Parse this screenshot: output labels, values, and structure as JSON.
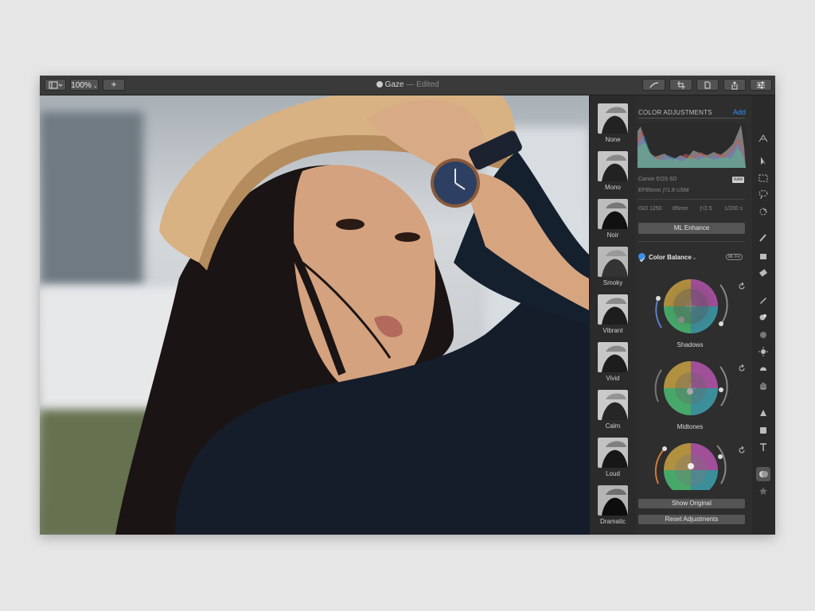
{
  "titlebar": {
    "zoom": "100%",
    "document_name": "Gaze",
    "status": "— Edited"
  },
  "presets": [
    {
      "label": "None"
    },
    {
      "label": "Mono"
    },
    {
      "label": "Noir"
    },
    {
      "label": "Smoky"
    },
    {
      "label": "Vibrant"
    },
    {
      "label": "Vivid"
    },
    {
      "label": "Calm"
    },
    {
      "label": "Loud"
    },
    {
      "label": "Dramatic"
    }
  ],
  "panel": {
    "title": "COLOR ADJUSTMENTS",
    "add_label": "Add",
    "camera": "Canon EOS 6D",
    "raw_badge": "RAW",
    "lens": "EF85mm ƒ/1.8 USM",
    "iso": "ISO 1250",
    "focal": "85mm",
    "aperture": "ƒ/2.5",
    "shutter": "1/200 s",
    "ml_enhance": "ML Enhance",
    "color_balance": "Color Balance",
    "ml_fix": "ML Fix",
    "wheels": [
      {
        "label": "Shadows"
      },
      {
        "label": "Midtones"
      },
      {
        "label": ""
      }
    ],
    "show_original": "Show Original",
    "reset": "Reset Adjustments"
  },
  "tools": [
    "repair-icon",
    "select-icon",
    "marquee-icon",
    "lasso-icon",
    "quick-select-icon",
    "brush-icon",
    "bucket-icon",
    "eraser-icon",
    "pencil-icon",
    "clone-icon",
    "blur-icon",
    "light-icon",
    "shape-icon",
    "hand-icon",
    "pen-icon",
    "rectangle-icon",
    "text-icon",
    "adjust-icon",
    "favorite-icon"
  ],
  "colors": {
    "accent": "#3a8ee6",
    "panel_bg": "#2e2e2e",
    "titlebar_bg": "#3a3a3a"
  }
}
